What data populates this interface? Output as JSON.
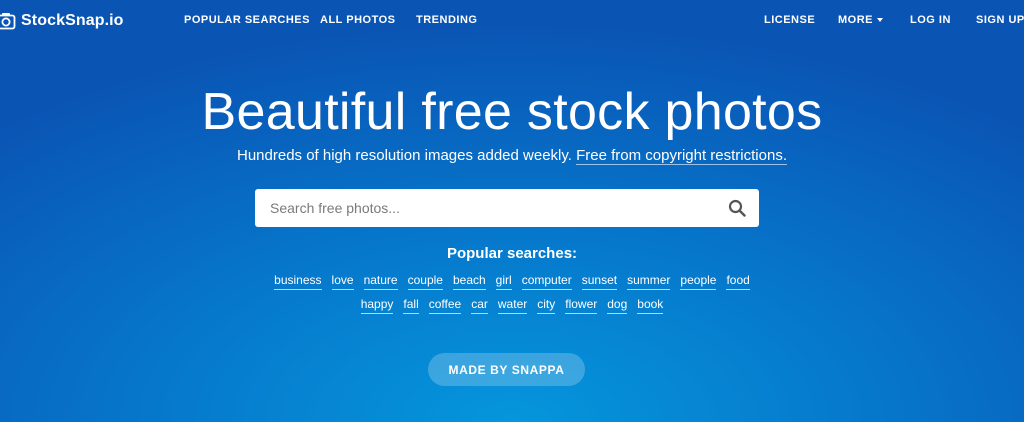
{
  "brand": {
    "name": "StockSnap.io"
  },
  "nav": {
    "left": [
      "POPULAR SEARCHES",
      "ALL PHOTOS",
      "TRENDING"
    ],
    "right": [
      "LICENSE",
      "MORE",
      "LOG IN",
      "SIGN UP"
    ]
  },
  "hero": {
    "title": "Beautiful free stock photos",
    "subtitle": "Hundreds of high resolution images added weekly.",
    "subtitle_link": "Free from copyright restrictions."
  },
  "search": {
    "placeholder": "Search free photos..."
  },
  "popular": {
    "heading": "Popular searches:",
    "row1": [
      "business",
      "love",
      "nature",
      "couple",
      "beach",
      "girl",
      "computer",
      "sunset",
      "summer",
      "people",
      "food"
    ],
    "row2": [
      "happy",
      "fall",
      "coffee",
      "car",
      "water",
      "city",
      "flower",
      "dog",
      "book"
    ]
  },
  "cta": {
    "label": "MADE BY SNAPPA"
  },
  "colors": {
    "bg_top": "#0a54b4",
    "bg_bottom": "#0596dc",
    "text": "#ffffff"
  },
  "icons": {
    "logo": "camera-icon",
    "search": "search-icon",
    "more": "caret-down-icon"
  }
}
